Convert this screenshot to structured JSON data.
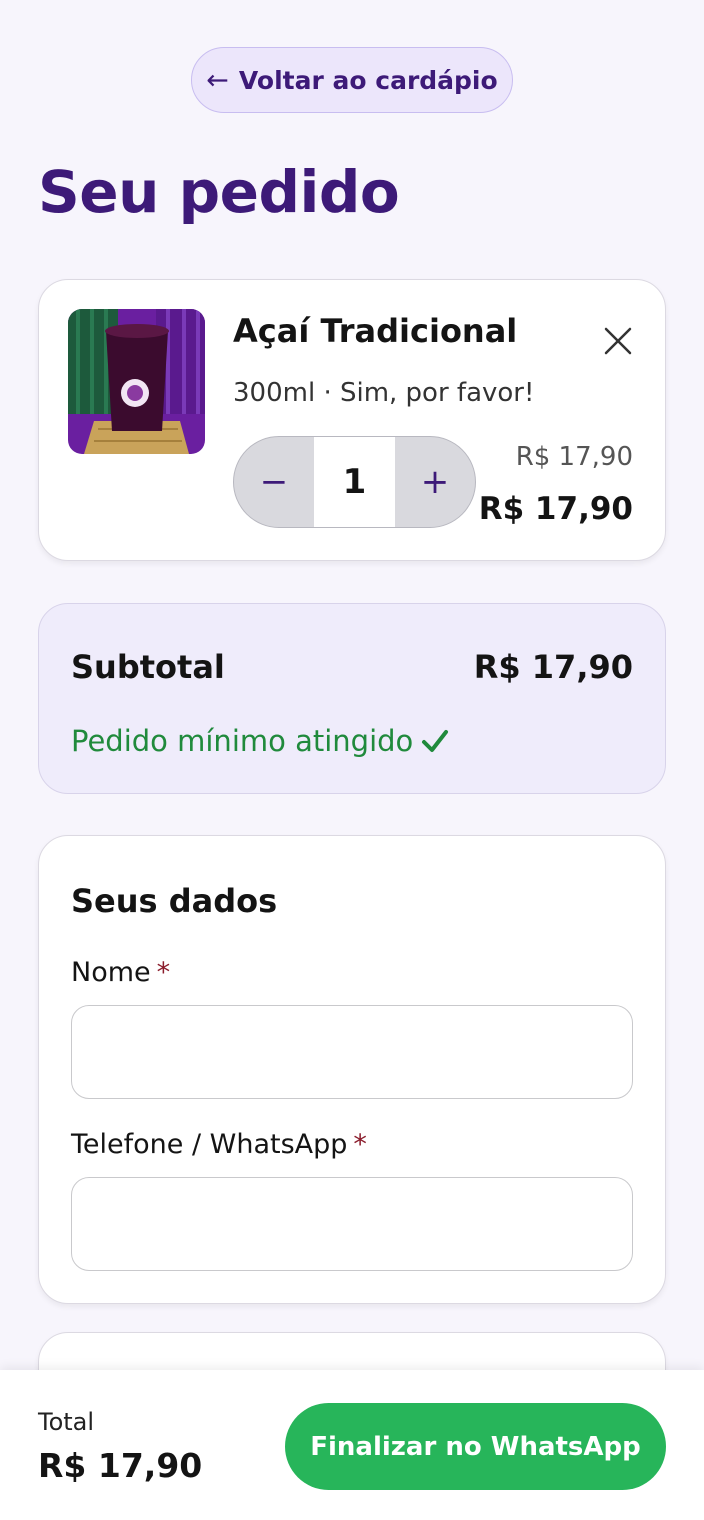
{
  "header": {
    "back_label": "Voltar ao cardápio",
    "back_icon": "arrow-left-icon",
    "title": "Seu pedido"
  },
  "cart": {
    "items": [
      {
        "name": "Açaí Tradicional",
        "description": "300ml · Sim, por favor!",
        "quantity": "1",
        "unit_price": "R$ 17,90",
        "line_total": "R$ 17,90"
      }
    ],
    "decrement_symbol": "−",
    "increment_symbol": "+"
  },
  "summary": {
    "subtotal_label": "Subtotal",
    "subtotal_value": "R$ 17,90",
    "min_order_text": "Pedido mínimo atingido",
    "min_order_color": "#208a3c"
  },
  "customer": {
    "section_title": "Seus dados",
    "name_label": "Nome",
    "name_value": "",
    "phone_label": "Telefone / WhatsApp",
    "phone_value": "",
    "required_mark": "*"
  },
  "footer": {
    "total_label": "Total",
    "total_value": "R$ 17,90",
    "finalize_label": "Finalizar no WhatsApp",
    "finalize_color": "#27b55a"
  },
  "colors": {
    "brand_purple": "#3d1a78",
    "background": "#f7f5fc"
  }
}
